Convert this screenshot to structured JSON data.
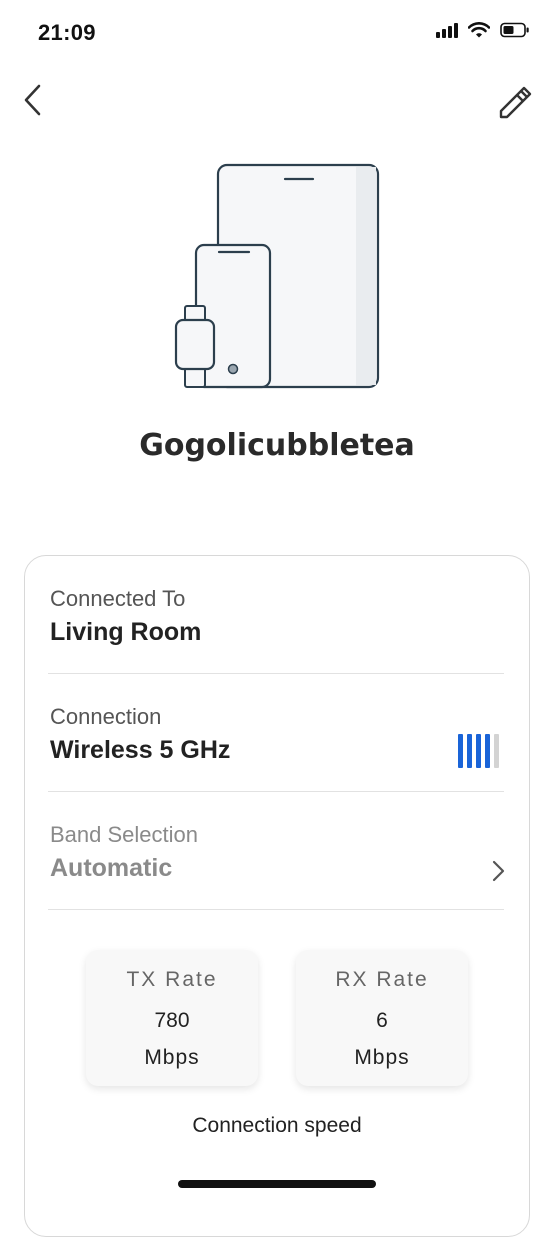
{
  "status_bar": {
    "time": "21:09"
  },
  "nav": {
    "back_icon": "chevron-left-icon",
    "edit_icon": "pencil-icon"
  },
  "device": {
    "name": "Gogolicubbletea",
    "icon": "devices-illustration"
  },
  "details": {
    "connected_to": {
      "label": "Connected To",
      "value": "Living Room"
    },
    "connection": {
      "label": "Connection",
      "value": "Wireless 5 GHz",
      "signal_level": 4,
      "signal_max": 5,
      "signal_color": "#1a64d8"
    },
    "band_selection": {
      "label": "Band Selection",
      "value": "Automatic"
    }
  },
  "rates": {
    "tx": {
      "title": "TX Rate",
      "value": "780",
      "unit": "Mbps"
    },
    "rx": {
      "title": "RX Rate",
      "value": "6",
      "unit": "Mbps"
    },
    "caption": "Connection speed"
  }
}
